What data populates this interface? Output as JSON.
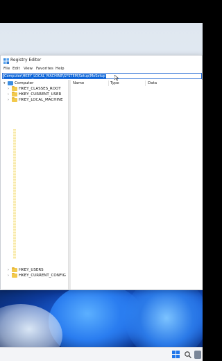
{
  "window": {
    "title": "Registry Editor",
    "menu": [
      "File",
      "Edit",
      "View",
      "Favorites",
      "Help"
    ],
    "address": "Computer\\HKEY_LOCAL_MACHINE\\SYSTEM\\Setup\\MoSetup"
  },
  "tree": {
    "root": "Computer",
    "hives_top": [
      "HKEY_CLASSES_ROOT",
      "HKEY_CURRENT_USER",
      "HKEY_LOCAL_MACHINE"
    ],
    "hives_bottom": [
      "HKEY_USERS",
      "HKEY_CURRENT_CONFIG"
    ]
  },
  "list": {
    "columns": [
      "Name",
      "Type",
      "Data"
    ]
  },
  "colors": {
    "selection": "#0a64d8",
    "folder": "#f2c94c",
    "accent": "#1f76ea"
  },
  "icons": [
    "registry-app-icon",
    "computer-icon",
    "folder-icon",
    "windows-start-icon",
    "search-icon"
  ]
}
